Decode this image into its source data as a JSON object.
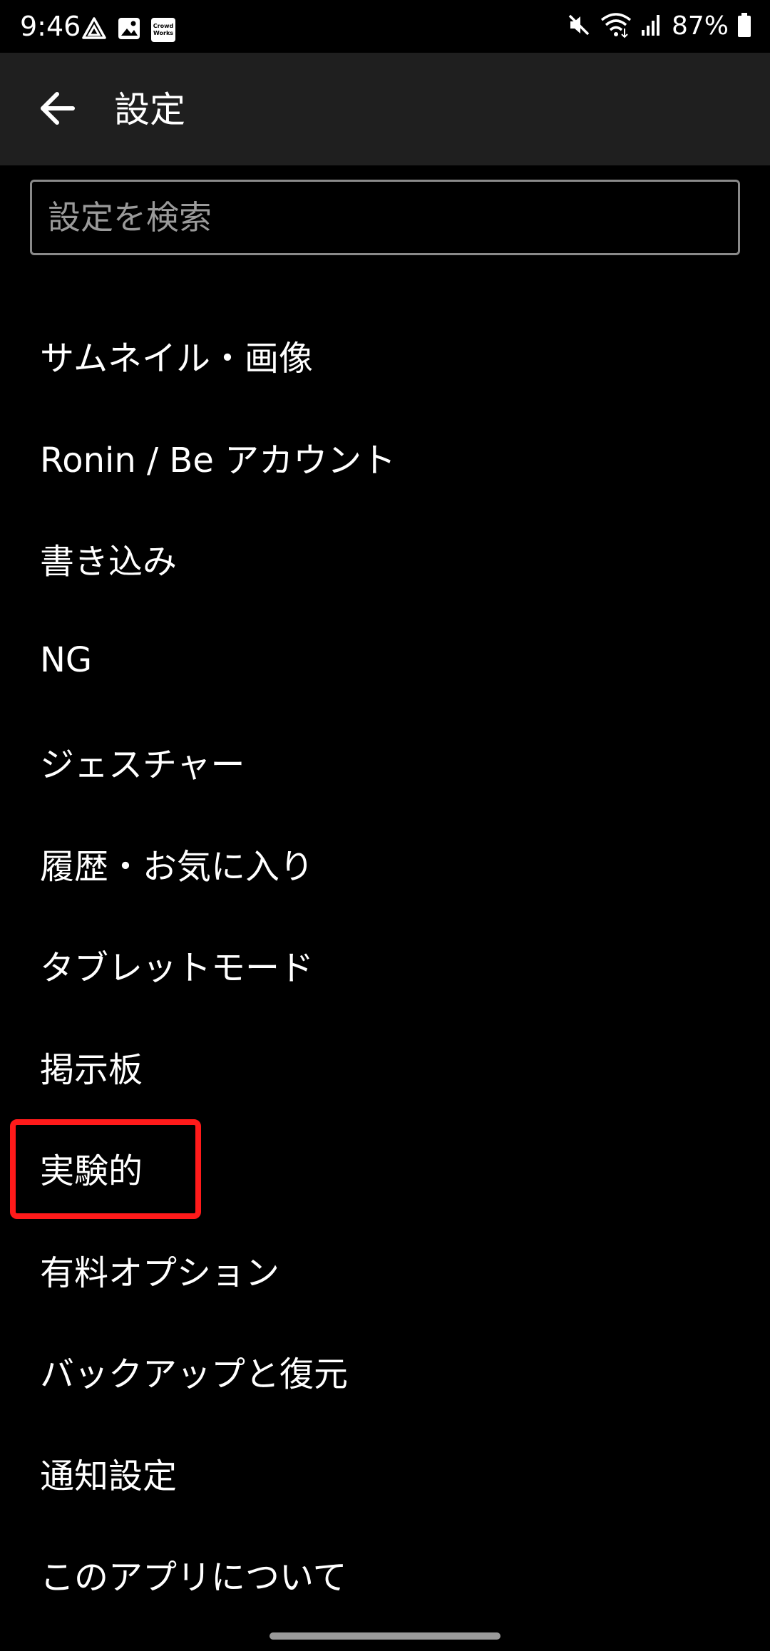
{
  "status_bar": {
    "time": "9:46",
    "crowdworks_badge_line1": "Crowd",
    "crowdworks_badge_line2": "Works",
    "battery_percent": "87%"
  },
  "app_bar": {
    "title": "設定",
    "back_icon": "arrow-left-icon"
  },
  "search": {
    "placeholder": "設定を検索",
    "value": ""
  },
  "menu": {
    "items": [
      {
        "label": "サムネイル・画像"
      },
      {
        "label": "Ronin / Be アカウント"
      },
      {
        "label": "書き込み"
      },
      {
        "label": "NG"
      },
      {
        "label": "ジェスチャー"
      },
      {
        "label": "履歴・お気に入り"
      },
      {
        "label": "タブレットモード"
      },
      {
        "label": "掲示板"
      },
      {
        "label": "実験的"
      },
      {
        "label": "有料オプション"
      },
      {
        "label": "バックアップと復元"
      },
      {
        "label": "通知設定"
      },
      {
        "label": "このアプリについて"
      }
    ]
  },
  "colors": {
    "background": "#000000",
    "app_bar": "#1f1f1f",
    "highlight": "#ff1a1a",
    "text": "#ffffff"
  }
}
